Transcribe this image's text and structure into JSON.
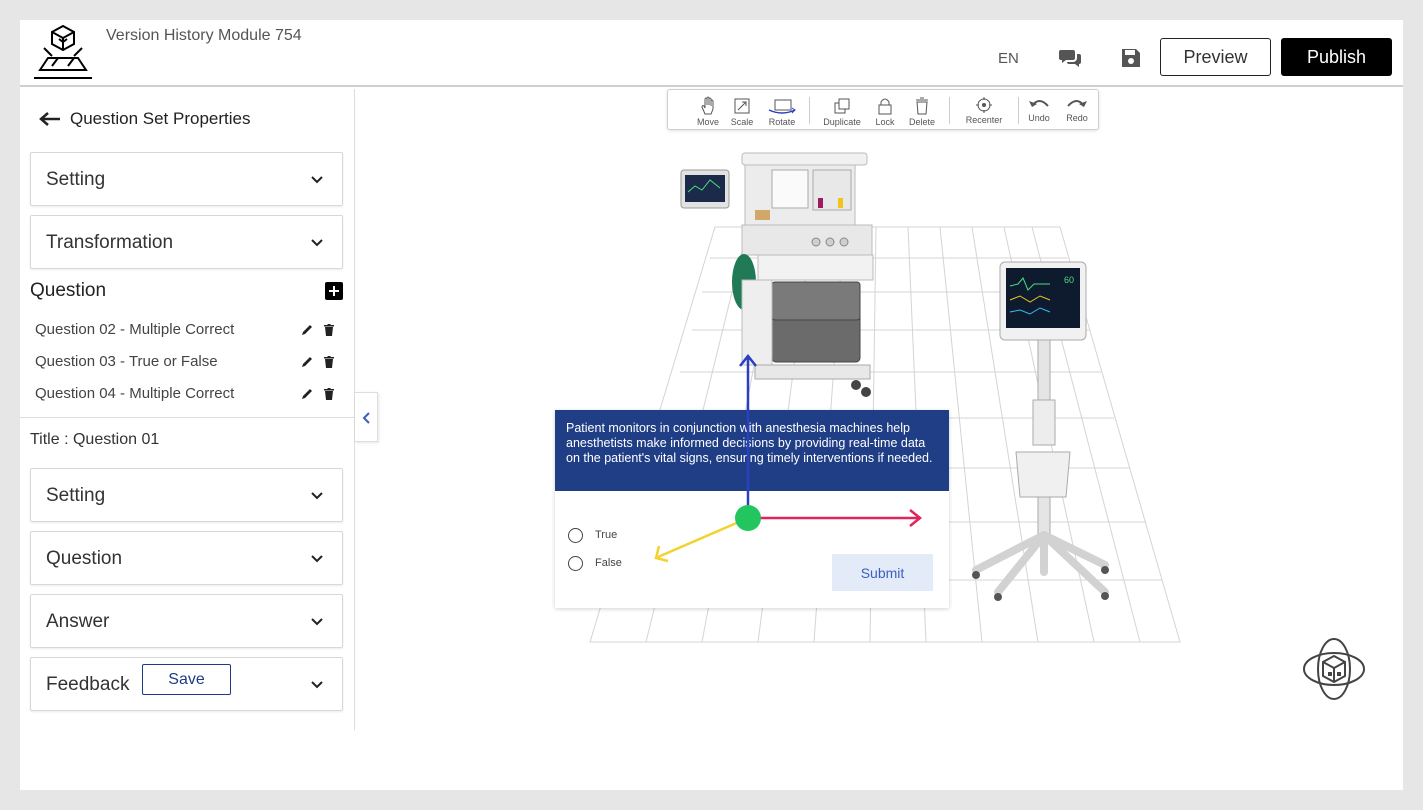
{
  "header": {
    "app_title": "Version History Module 754",
    "language": "EN",
    "preview_label": "Preview",
    "publish_label": "Publish"
  },
  "sidebar": {
    "back_label": "Question Set Properties",
    "set_accordions": [
      "Setting",
      "Transformation"
    ],
    "question_heading": "Question",
    "questions": [
      "Question 02 - Multiple Correct",
      "Question 03 - True or False",
      "Question 04 - Multiple Correct"
    ],
    "title_label": "Title : Question 01",
    "item_accordions": [
      "Setting",
      "Question",
      "Answer",
      "Feedback"
    ],
    "save_label": "Save"
  },
  "toolbar": {
    "tools": [
      "Move",
      "Scale",
      "Rotate",
      "Duplicate",
      "Lock",
      "Delete",
      "Recenter",
      "Undo",
      "Redo"
    ]
  },
  "quiz": {
    "question": "Patient monitors in conjunction with anesthesia machines help anesthetists make informed decisions by providing real-time data on the patient's vital signs, ensuring timely interventions if needed.",
    "options": [
      "True",
      "False"
    ],
    "submit_label": "Submit"
  },
  "monitor_reading": "60",
  "colors": {
    "primary_dark": "#000000",
    "quiz_header": "#1f3e86",
    "gizmo_x": "#e0245e",
    "gizmo_y": "#2b3fc1",
    "gizmo_z": "#f2d22e",
    "gizmo_center": "#22c55e"
  }
}
